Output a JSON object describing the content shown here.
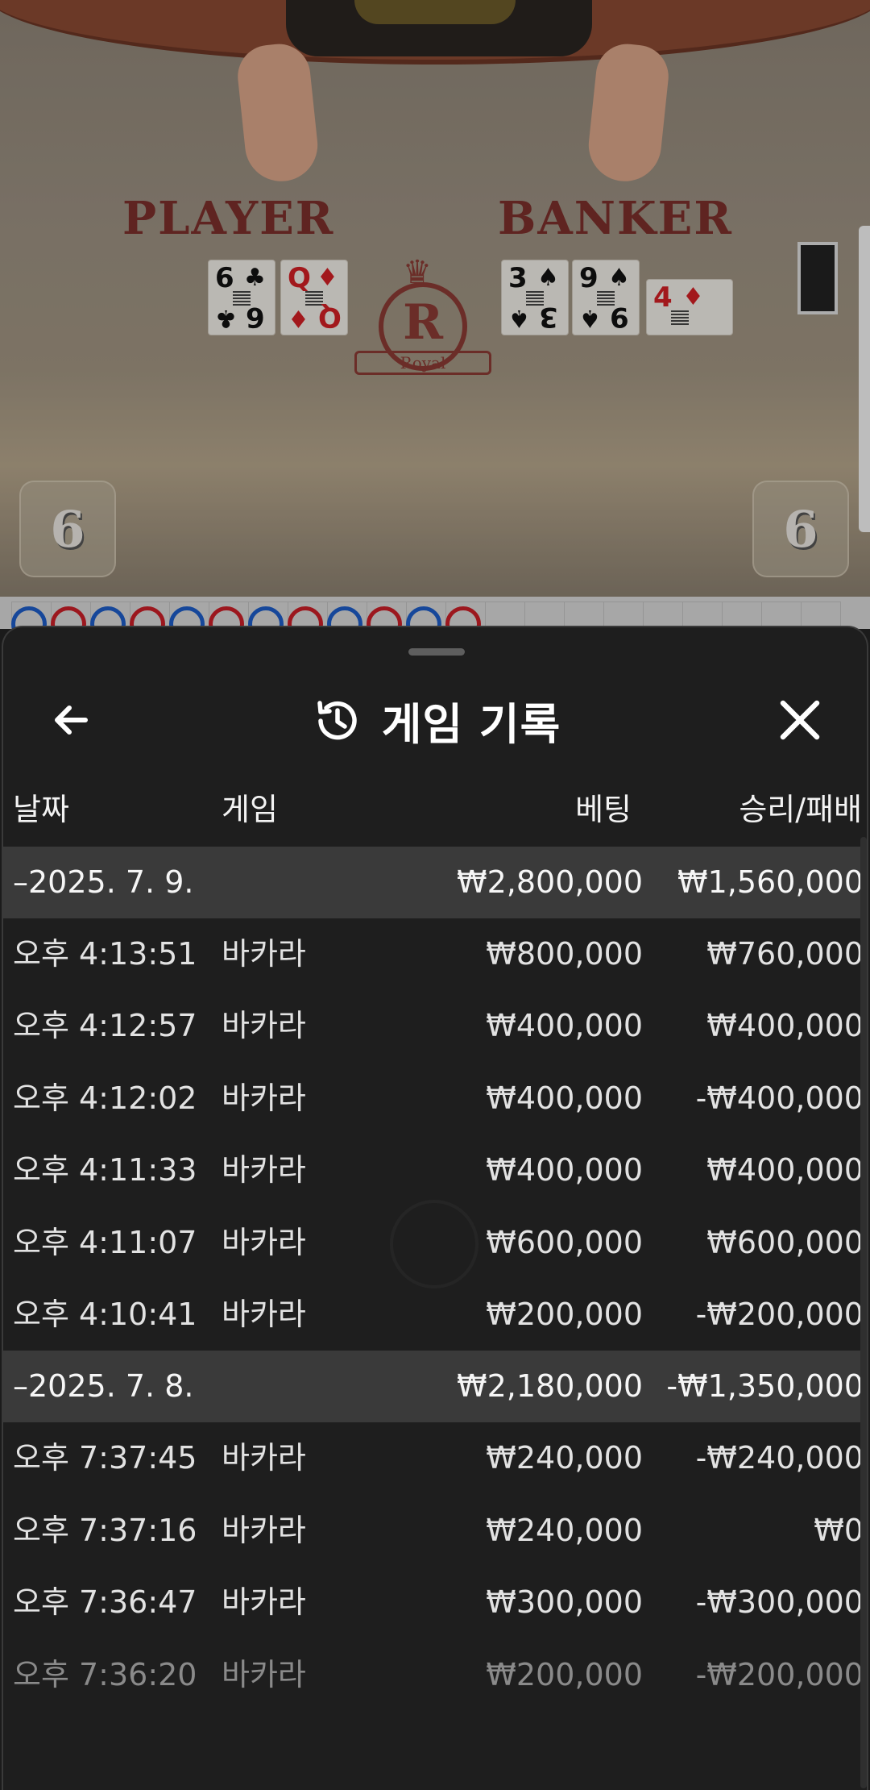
{
  "video": {
    "player_label": "PLAYER",
    "banker_label": "BANKER",
    "player_score": "6",
    "banker_score": "6",
    "emblem_letter": "R",
    "emblem_text": "Royal",
    "player_cards": [
      {
        "rank": "6",
        "suit": "♣",
        "color": "black"
      },
      {
        "rank": "Q",
        "suit": "♦",
        "color": "red"
      }
    ],
    "banker_cards": [
      {
        "rank": "3",
        "suit": "♠",
        "color": "black"
      },
      {
        "rank": "9",
        "suit": "♠",
        "color": "black"
      },
      {
        "rank": "4",
        "suit": "♦",
        "color": "red"
      }
    ],
    "road_beads": [
      "p",
      "b",
      "p",
      "b",
      "p",
      "b",
      "p",
      "b",
      "p",
      "b",
      "p",
      "b"
    ]
  },
  "sheet": {
    "title": "게임 기록",
    "back_icon": "arrow-left-icon",
    "title_icon": "history-icon",
    "close_icon": "close-icon",
    "columns": {
      "date": "날짜",
      "game": "게임",
      "bet": "베팅",
      "win_loss": "승리/패배"
    },
    "groups": [
      {
        "date": "–2025. 7. 9.",
        "bet_total": "₩2,800,000",
        "win_loss_total": "₩1,560,000",
        "rows": [
          {
            "time": "오후 4:13:51",
            "game": "바카라",
            "bet": "₩800,000",
            "win_loss": "₩760,000"
          },
          {
            "time": "오후 4:12:57",
            "game": "바카라",
            "bet": "₩400,000",
            "win_loss": "₩400,000"
          },
          {
            "time": "오후 4:12:02",
            "game": "바카라",
            "bet": "₩400,000",
            "win_loss": "-₩400,000"
          },
          {
            "time": "오후 4:11:33",
            "game": "바카라",
            "bet": "₩400,000",
            "win_loss": "₩400,000"
          },
          {
            "time": "오후 4:11:07",
            "game": "바카라",
            "bet": "₩600,000",
            "win_loss": "₩600,000"
          },
          {
            "time": "오후 4:10:41",
            "game": "바카라",
            "bet": "₩200,000",
            "win_loss": "-₩200,000"
          }
        ]
      },
      {
        "date": "–2025. 7. 8.",
        "bet_total": "₩2,180,000",
        "win_loss_total": "-₩1,350,000",
        "rows": [
          {
            "time": "오후 7:37:45",
            "game": "바카라",
            "bet": "₩240,000",
            "win_loss": "-₩240,000"
          },
          {
            "time": "오후 7:37:16",
            "game": "바카라",
            "bet": "₩240,000",
            "win_loss": "₩0"
          },
          {
            "time": "오후 7:36:47",
            "game": "바카라",
            "bet": "₩300,000",
            "win_loss": "-₩300,000"
          },
          {
            "time": "오후 7:36:20",
            "game": "바카라",
            "bet": "₩200,000",
            "win_loss": "-₩200,000"
          }
        ]
      }
    ]
  }
}
